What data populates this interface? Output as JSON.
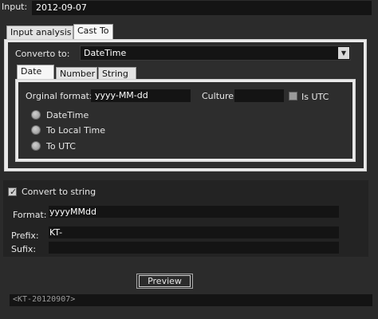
{
  "input": {
    "label": "Input:",
    "value": "2012-09-07"
  },
  "outer_tabs": [
    {
      "label": "Input analysis"
    },
    {
      "label": "Cast To"
    }
  ],
  "convert": {
    "label": "Converto to:",
    "value": "DateTime"
  },
  "inner_tabs": [
    {
      "label": "Date"
    },
    {
      "label": "Number"
    },
    {
      "label": "String"
    }
  ],
  "date": {
    "original_format_label": "Orginal format:",
    "original_format_value": "yyyy-MM-dd",
    "culture_label": "Culture",
    "culture_value": "",
    "is_utc_label": "Is UTC",
    "options": [
      {
        "label": "DateTime"
      },
      {
        "label": "To Local Time"
      },
      {
        "label": "To UTC"
      }
    ]
  },
  "convert_to_string": {
    "label": "Convert to string",
    "checked": true,
    "format_label": "Format:",
    "format_value": "yyyyMMdd",
    "prefix_label": "Prefix:",
    "prefix_value": "KT-",
    "sufix_label": "Sufix:",
    "sufix_value": ""
  },
  "preview": {
    "button_label": "Preview",
    "result": "<KT-20120907>"
  },
  "icons": {
    "dropdown": "chevron-down-icon",
    "check": "checkmark-icon",
    "radio": "radio-icon"
  }
}
